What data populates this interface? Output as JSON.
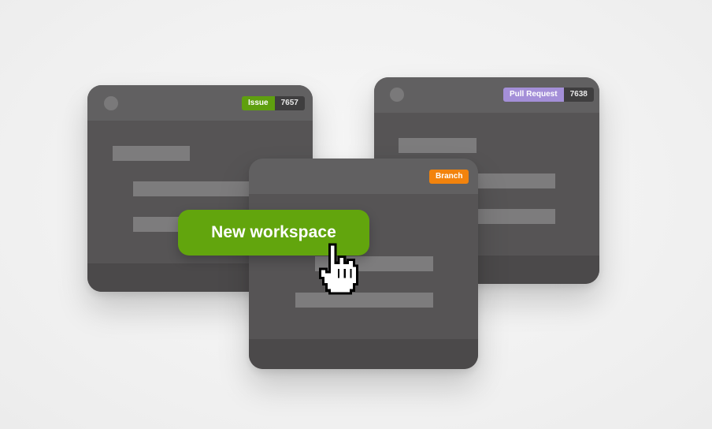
{
  "cards": {
    "issue": {
      "badge_label": "Issue",
      "badge_number": "7657"
    },
    "pull_request": {
      "badge_label": "Pull Request",
      "badge_number": "7638"
    },
    "branch": {
      "badge_label": "Branch"
    }
  },
  "cta": {
    "label": "New workspace"
  },
  "icons": {
    "cursor": "pointing-hand-cursor-icon",
    "window_dot": "window-dot-icon"
  },
  "colors": {
    "issue_badge": "#5f9f0f",
    "pull_request_badge": "#a48fd8",
    "branch_badge": "#f2830d",
    "cta_background": "#62a50d",
    "card_body": "#565455"
  }
}
